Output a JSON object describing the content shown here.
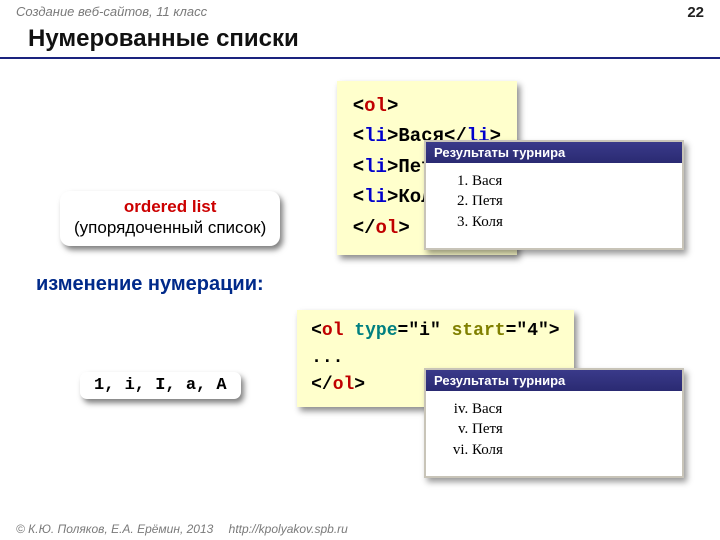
{
  "header": {
    "course": "Создание веб-сайтов, 11 класс",
    "page": "22"
  },
  "title": "Нумерованные списки",
  "callout": {
    "line1": "ordered list",
    "line2": "(упорядоченный список)"
  },
  "code1": {
    "open": "ol",
    "li": "li",
    "items": [
      "Вася",
      "Петя",
      "Коля"
    ],
    "close": "ol"
  },
  "browser1": {
    "title": "Результаты турнира",
    "items": [
      "Вася",
      "Петя",
      "Коля"
    ]
  },
  "subheading": "изменение нумерации:",
  "pill": "1, i, I, a, A",
  "code2": {
    "open_tag": "ol",
    "attr1_name": "type",
    "attr1_val": "\"i\"",
    "attr2_name": "start",
    "attr2_val": "\"4\"",
    "body": "...",
    "close": "ol"
  },
  "browser2": {
    "title": "Результаты турнира",
    "items": [
      "Вася",
      "Петя",
      "Коля"
    ]
  },
  "footer": {
    "copyright": "© К.Ю. Поляков, Е.А. Ерёмин, 2013",
    "url": "http://kpolyakov.spb.ru"
  }
}
